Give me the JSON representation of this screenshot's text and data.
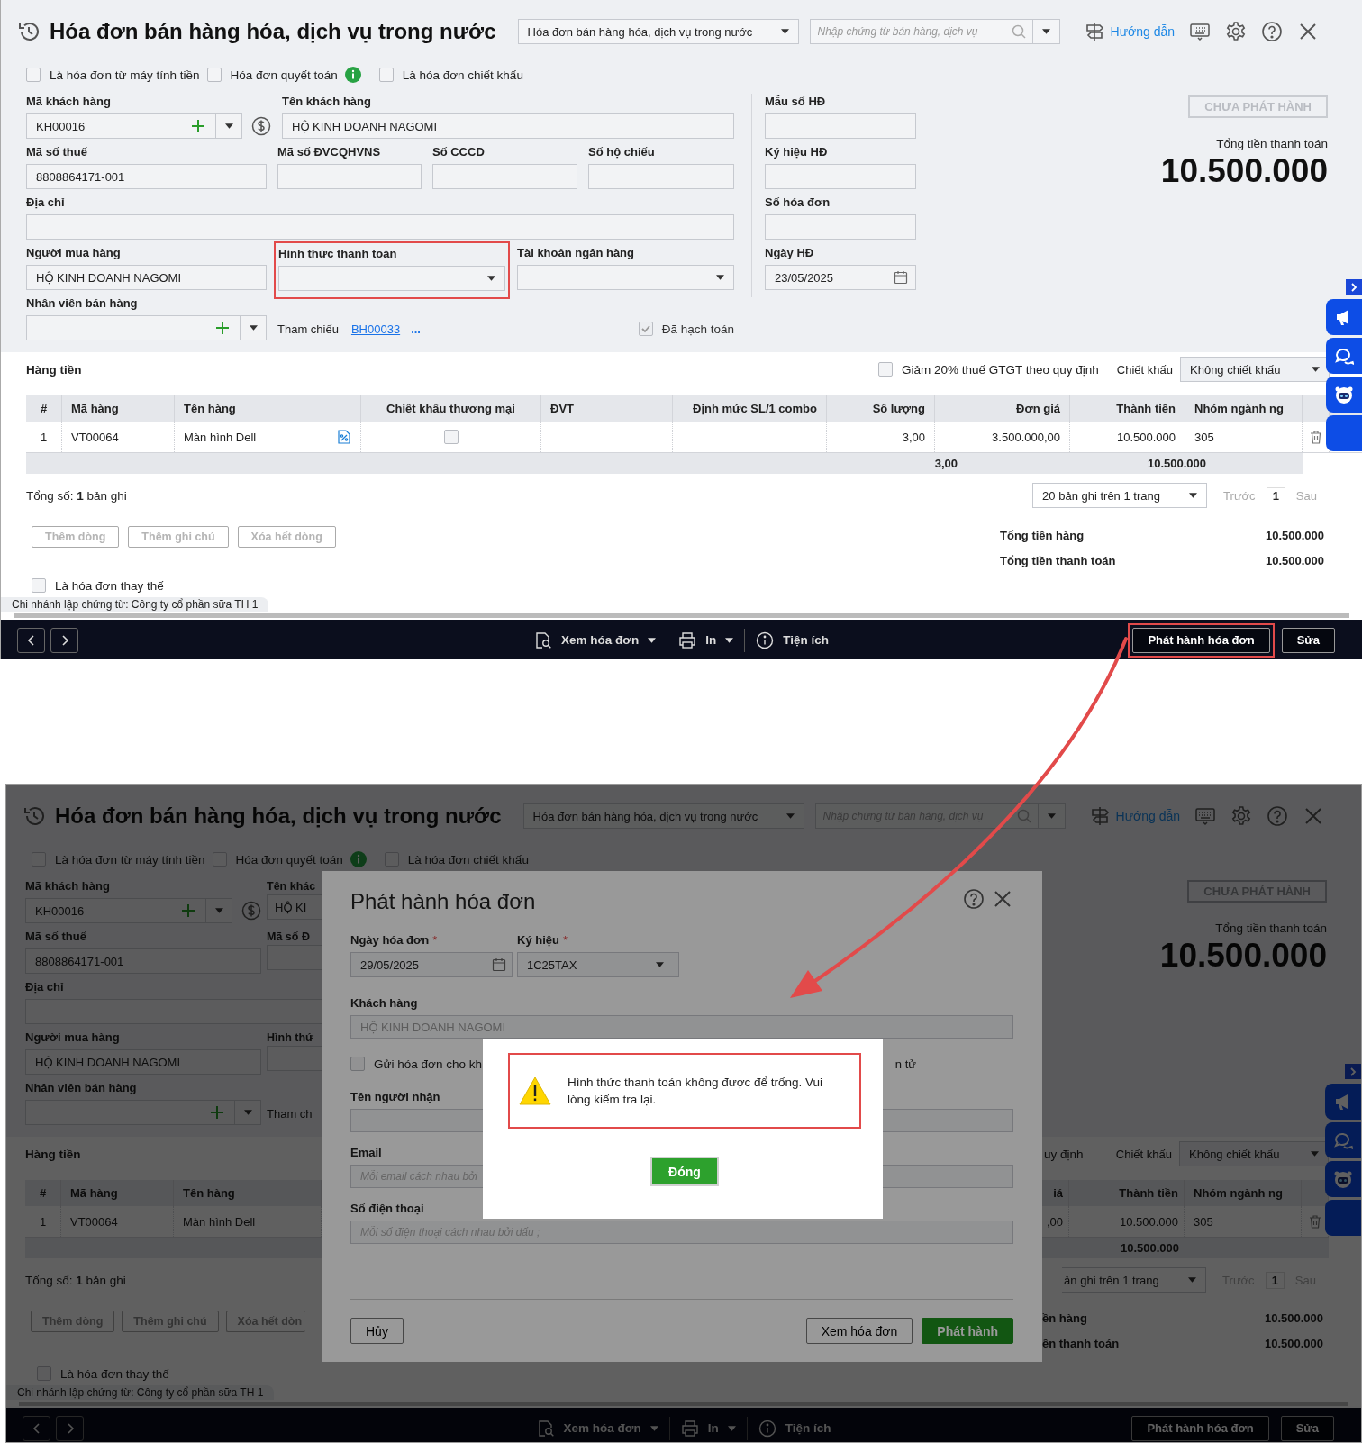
{
  "invoice_screen": {
    "title": "Hóa đơn bán hàng hóa, dịch vụ trong nước",
    "type_select": "Hóa đơn bán hàng hóa, dịch vụ trong nước",
    "search": {
      "placeholder": "Nhập chứng từ bán hàng, dịch vụ"
    },
    "guide_link": "Hướng dẫn",
    "options": [
      {
        "label": "Là hóa đơn từ máy tính tiền",
        "checked": false
      },
      {
        "label": "Hóa đơn quyết toán",
        "checked": false,
        "info": true
      },
      {
        "label": "Là hóa đơn chiết khấu",
        "checked": false
      }
    ],
    "form_rows": [
      [
        {
          "kind": "combo",
          "label": "Mã khách hàng",
          "value": "KH00016",
          "highlighted": false
        },
        {
          "kind": "text",
          "label": "Tên khách hàng",
          "value": "HỘ KINH DOANH NAGOMI",
          "highlighted": false
        }
      ],
      [
        {
          "kind": "text",
          "label": "Mã số thuế",
          "value": "8808864171-001",
          "highlighted": false
        },
        {
          "kind": "text",
          "label": "Mã số ĐVCQHVNS",
          "highlighted": false
        },
        {
          "kind": "text",
          "label": "Số CCCD",
          "highlighted": false
        },
        {
          "kind": "text",
          "label": "Số hộ chiếu",
          "highlighted": false
        }
      ],
      [
        {
          "kind": "text",
          "label": "Địa chỉ",
          "highlighted": false
        }
      ],
      [
        {
          "kind": "text",
          "label": "Người mua hàng",
          "value": "HỘ KINH DOANH NAGOMI",
          "highlighted": false
        },
        {
          "kind": "select",
          "label": "Hình thức thanh toán",
          "highlighted": true
        },
        {
          "kind": "select",
          "label": "Tài khoản ngân hàng",
          "highlighted": false
        }
      ],
      [
        {
          "kind": "combo",
          "label": "Nhân viên bán hàng",
          "highlighted": false
        }
      ]
    ],
    "reference": {
      "label": "Tham chiếu",
      "link": "BH00033",
      "more": "..."
    },
    "posted": {
      "label": "Đã hạch toán",
      "checked": true
    },
    "invoice_fields": [
      {
        "kind": "text",
        "label": "Mẫu số HĐ"
      },
      {
        "kind": "text",
        "label": "Ký hiệu HĐ"
      },
      {
        "kind": "text",
        "label": "Số hóa đơn"
      },
      {
        "kind": "date",
        "label": "Ngày HĐ",
        "value": "23/05/2025"
      }
    ],
    "status": "CHƯA PHÁT HÀNH",
    "total_label": "Tổng tiền thanh toán",
    "total_value": "10.500.000",
    "items": {
      "title": "Hàng tiền",
      "vat_reduction": {
        "label": "Giảm 20% thuế GTGT theo quy định",
        "checked": false
      },
      "discount_label": "Chiết khấu",
      "discount_select": "Không chiết khấu",
      "columns": [
        "#",
        "Mã hàng",
        "Tên hàng",
        "Chiết khấu thương mại",
        "ĐVT",
        "Định mức SL/1 combo",
        "Số lượng",
        "Đơn giá",
        "Thành tiền",
        "Nhóm ngành ng"
      ],
      "rows": [
        {
          "cells": [
            {
              "kind": "text",
              "value": "1"
            },
            {
              "kind": "text",
              "value": "VT00064"
            },
            {
              "kind": "name",
              "value": "Màn hình Dell"
            },
            {
              "kind": "check",
              "checked": false
            },
            {
              "kind": "blank"
            },
            {
              "kind": "blank"
            },
            {
              "kind": "text",
              "value": "3,00"
            },
            {
              "kind": "text",
              "value": "3.500.000,00"
            },
            {
              "kind": "text",
              "value": "10.500.000"
            },
            {
              "kind": "text",
              "value": "305"
            }
          ]
        }
      ],
      "quantity_total": "3,00",
      "amount_total": "10.500.000",
      "record_count": "Tổng số: **1** bản ghi",
      "pager": {
        "page_size": "20 bản ghi trên 1 trang",
        "prev": "Trước",
        "page": "1",
        "next": "Sau"
      },
      "buttons": [
        {
          "label": "Thêm dòng",
          "disabled": true
        },
        {
          "label": "Thêm ghi chú",
          "disabled": true
        },
        {
          "label": "Xóa hết dòng",
          "disabled": true
        }
      ],
      "summary": [
        {
          "label": "Tổng tiền hàng",
          "value": "10.500.000"
        },
        {
          "label": "Tổng tiền thanh toán",
          "value": "10.500.000"
        }
      ]
    },
    "replacement": {
      "label": "Là hóa đơn thay thế",
      "checked": false
    },
    "branch": "Chi nhánh lập chứng từ: Công ty cổ phần sữa TH 1",
    "toolbar": {
      "actions": [
        {
          "kind": "preview",
          "label": "Xem hóa đơn",
          "dropdown": true
        },
        {
          "kind": "print",
          "label": "In",
          "dropdown": true
        },
        {
          "kind": "utility",
          "label": "Tiện ích",
          "dropdown": false
        }
      ],
      "issue": {
        "label": "Phát hành hóa đơn",
        "highlighted": true
      },
      "edit": "Sửa"
    }
  },
  "issue_screen": {
    "title": "Hóa đơn bán hàng hóa, dịch vụ trong nước",
    "type_select": "Hóa đơn bán hàng hóa, dịch vụ trong nước",
    "search": {
      "placeholder": "Nhập chứng từ bán hàng, dịch vụ"
    },
    "guide_link": "Hướng dẫn",
    "options": [
      {
        "label": "Là hóa đơn từ máy tính tiền",
        "checked": false
      },
      {
        "label": "Hóa đơn quyết toán",
        "checked": false,
        "info": true
      },
      {
        "label": "Là hóa đơn chiết khấu",
        "checked": false
      }
    ],
    "left_rows": [
      {
        "field": {
          "kind": "combo",
          "label": "Mã khách hàng",
          "value": "KH00016"
        },
        "cut": {
          "label": "Tên khác",
          "value": "HỘ KI"
        }
      },
      {
        "field": {
          "kind": "text",
          "label": "Mã số thuế",
          "value": "8808864171-001"
        },
        "cut": {
          "label": "Mã số Đ"
        }
      },
      {
        "field": {
          "kind": "wide",
          "label": "Địa chỉ"
        }
      },
      {
        "field": {
          "kind": "text",
          "label": "Người mua hàng",
          "value": "HỘ KINH DOANH NAGOMI"
        },
        "cut": {
          "label": "Hình thứ"
        }
      },
      {
        "field": {
          "kind": "combo",
          "label": "Nhân viên bán hàng"
        },
        "cut_text": "Tham ch"
      }
    ],
    "left_items": {
      "title": "Hàng tiền",
      "columns": [
        "#",
        "Mã hàng",
        "Tên hàng"
      ],
      "row": [
        "1",
        "VT00064",
        "Màn hình Dell"
      ],
      "record_count": "Tổng số: **1** bản ghi",
      "buttons": [
        {
          "label": "Thêm dòng",
          "disabled": true
        },
        {
          "label": "Thêm ghi chú",
          "disabled": true
        },
        {
          "label": "Xóa hết dòn",
          "disabled": true
        }
      ]
    },
    "status": "CHƯA PHÁT HÀNH",
    "total_label": "Tổng tiền thanh toán",
    "total_value": "10.500.000",
    "right_items": {
      "vat_tail": "uy định",
      "discount_label": "Chiết khấu",
      "discount_select": "Không chiết khấu",
      "columns": [
        "iá",
        "Thành tiền",
        "Nhóm ngành ng"
      ],
      "row": [
        ",00",
        "10.500.000",
        "305"
      ],
      "amount_total": "10.500.000",
      "pager": {
        "page_size": "ản ghi trên 1 trang",
        "prev": "Trước",
        "page": "1",
        "next": "Sau"
      },
      "summary": [
        {
          "label": "ền hàng",
          "value": "10.500.000"
        },
        {
          "label": "ền thanh toán",
          "value": "10.500.000"
        }
      ]
    },
    "dialog": {
      "title": "Phát hành hóa đơn",
      "date": {
        "label": "Ngày hóa đơn",
        "required": "*",
        "value": "29/05/2025"
      },
      "series": {
        "label": "Ký hiệu",
        "required": "*",
        "value": "1C25TAX"
      },
      "customer": {
        "label": "Khách hàng",
        "value": "HỘ KINH DOANH NAGOMI"
      },
      "send_email": {
        "label": "Gửi hóa đơn cho kh",
        "checked": false,
        "tail": "n tử"
      },
      "recipient": {
        "label": "Tên người nhận"
      },
      "email": {
        "label": "Email",
        "placeholder": "Mỗi email cách nhau bởi"
      },
      "phone": {
        "label": "Số điện thoại",
        "placeholder": "Mỗi số điện thoại cách nhau bởi dấu ;"
      },
      "cancel": "Hủy",
      "preview": "Xem hóa đơn",
      "issue": "Phát hành"
    },
    "alert": {
      "message": "Hình thức thanh toán không được để trống. Vui lòng kiểm tra lại.",
      "highlighted": true,
      "button": "Đóng"
    },
    "replacement": {
      "label": "Là hóa đơn thay thế",
      "checked": false
    },
    "branch": "Chi nhánh lập chứng từ: Công ty cổ phần sữa TH 1",
    "toolbar": {
      "actions": [
        {
          "kind": "preview",
          "label": "Xem hóa đơn",
          "dropdown": true
        },
        {
          "kind": "print",
          "label": "In",
          "dropdown": true
        },
        {
          "kind": "utility",
          "label": "Tiện ích",
          "dropdown": false
        }
      ],
      "issue": {
        "label": "Phát hành hóa đơn",
        "highlighted": false
      },
      "edit": "Sửa"
    }
  }
}
